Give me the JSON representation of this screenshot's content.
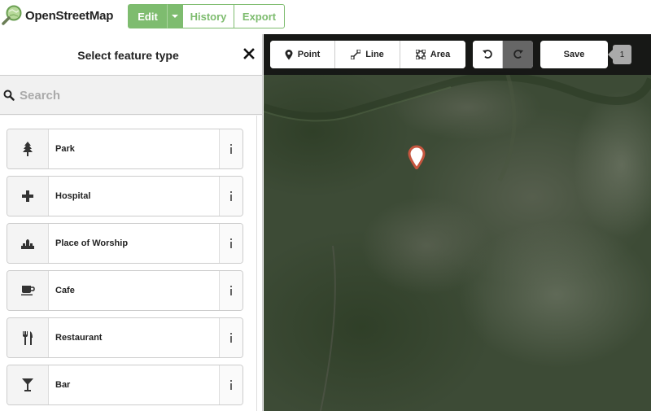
{
  "app": {
    "title": "OpenStreetMap"
  },
  "nav": {
    "edit_label": "Edit",
    "history_label": "History",
    "export_label": "Export"
  },
  "sidebar": {
    "title": "Select feature type",
    "search_placeholder": "Search",
    "search_value": "",
    "features": [
      {
        "label": "Park",
        "icon": "park-tree-icon"
      },
      {
        "label": "Hospital",
        "icon": "hospital-cross-icon"
      },
      {
        "label": "Place of Worship",
        "icon": "place-of-worship-icon"
      },
      {
        "label": "Cafe",
        "icon": "cafe-cup-icon"
      },
      {
        "label": "Restaurant",
        "icon": "restaurant-fork-knife-icon"
      },
      {
        "label": "Bar",
        "icon": "bar-cocktail-icon"
      }
    ]
  },
  "toolbar": {
    "point_label": "Point",
    "line_label": "Line",
    "area_label": "Area",
    "save_label": "Save",
    "edit_count": "1"
  },
  "colors": {
    "brand_green": "#7ebc6f",
    "toolbar_bg": "#141414",
    "marker_red": "#c6563f"
  }
}
